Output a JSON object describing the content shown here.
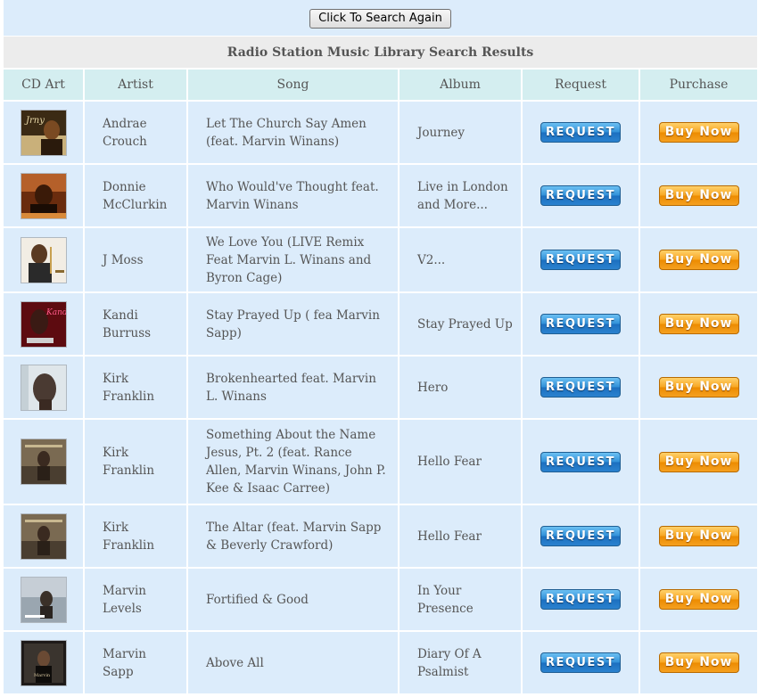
{
  "toolbar": {
    "search_again_label": "Click To Search Again"
  },
  "table": {
    "caption": "Radio Station Music Library Search Results",
    "headers": {
      "cd_art": "CD Art",
      "artist": "Artist",
      "song": "Song",
      "album": "Album",
      "request": "Request",
      "purchase": "Purchase"
    },
    "request_label": "REQUEST",
    "buy_label": "Buy Now",
    "rows": [
      {
        "artist": "Andrae Crouch",
        "song": "Let The Church Say Amen (feat. Marvin Winans)",
        "album": "Journey"
      },
      {
        "artist": "Donnie McClurkin",
        "song": "Who Would've Thought feat. Marvin Winans",
        "album": "Live in London and More..."
      },
      {
        "artist": "J Moss",
        "song": "We Love You (LIVE Remix Feat Marvin L. Winans and Byron Cage)",
        "album": "V2..."
      },
      {
        "artist": "Kandi Burruss",
        "song": "Stay Prayed Up ( fea Marvin Sapp)",
        "album": "Stay Prayed Up"
      },
      {
        "artist": "Kirk Franklin",
        "song": "Brokenhearted feat. Marvin L. Winans",
        "album": "Hero"
      },
      {
        "artist": "Kirk Franklin",
        "song": "Something About the Name Jesus, Pt. 2 (feat. Rance Allen, Marvin Winans, John P. Kee & Isaac Carree)",
        "album": "Hello Fear"
      },
      {
        "artist": "Kirk Franklin",
        "song": "The Altar (feat. Marvin Sapp & Beverly Crawford)",
        "album": "Hello Fear"
      },
      {
        "artist": "Marvin Levels",
        "song": "Fortified & Good",
        "album": "In Your Presence"
      },
      {
        "artist": "Marvin Sapp",
        "song": "Above All",
        "album": "Diary Of A Psalmist"
      }
    ]
  }
}
